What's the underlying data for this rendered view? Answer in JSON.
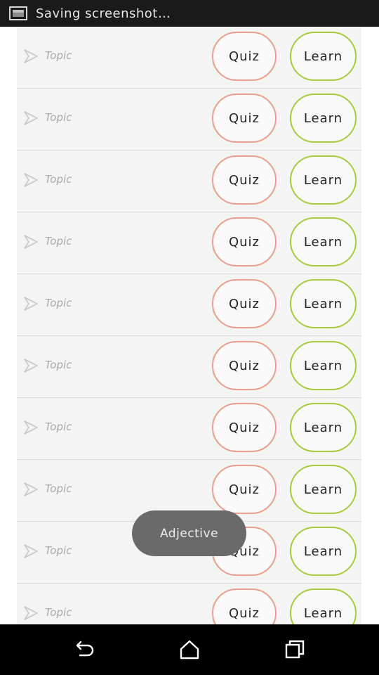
{
  "status_bar": {
    "icon": "screenshot-icon",
    "text": "Saving screenshot…"
  },
  "list": {
    "rows": [
      {
        "topic": "Topic",
        "quiz_label": "Quiz",
        "learn_label": "Learn"
      },
      {
        "topic": "Topic",
        "quiz_label": "Quiz",
        "learn_label": "Learn"
      },
      {
        "topic": "Topic",
        "quiz_label": "Quiz",
        "learn_label": "Learn"
      },
      {
        "topic": "Topic",
        "quiz_label": "Quiz",
        "learn_label": "Learn"
      },
      {
        "topic": "Topic",
        "quiz_label": "Quiz",
        "learn_label": "Learn"
      },
      {
        "topic": "Topic",
        "quiz_label": "Quiz",
        "learn_label": "Learn"
      },
      {
        "topic": "Topic",
        "quiz_label": "Quiz",
        "learn_label": "Learn"
      },
      {
        "topic": "Topic",
        "quiz_label": "Quiz",
        "learn_label": "Learn"
      },
      {
        "topic": "Topic",
        "quiz_label": "Quiz",
        "learn_label": "Learn"
      },
      {
        "topic": "Topic",
        "quiz_label": "Quiz",
        "learn_label": "Learn"
      }
    ]
  },
  "toast": {
    "text": "Adjective"
  },
  "nav_bar": {
    "back_icon": "back-icon",
    "home_icon": "home-icon",
    "recents_icon": "recents-icon"
  },
  "colors": {
    "quiz_border": "#e8a08c",
    "learn_border": "#a4cc3a",
    "row_background": "#f4f4f4",
    "toast_background": "#6a6a6a"
  }
}
